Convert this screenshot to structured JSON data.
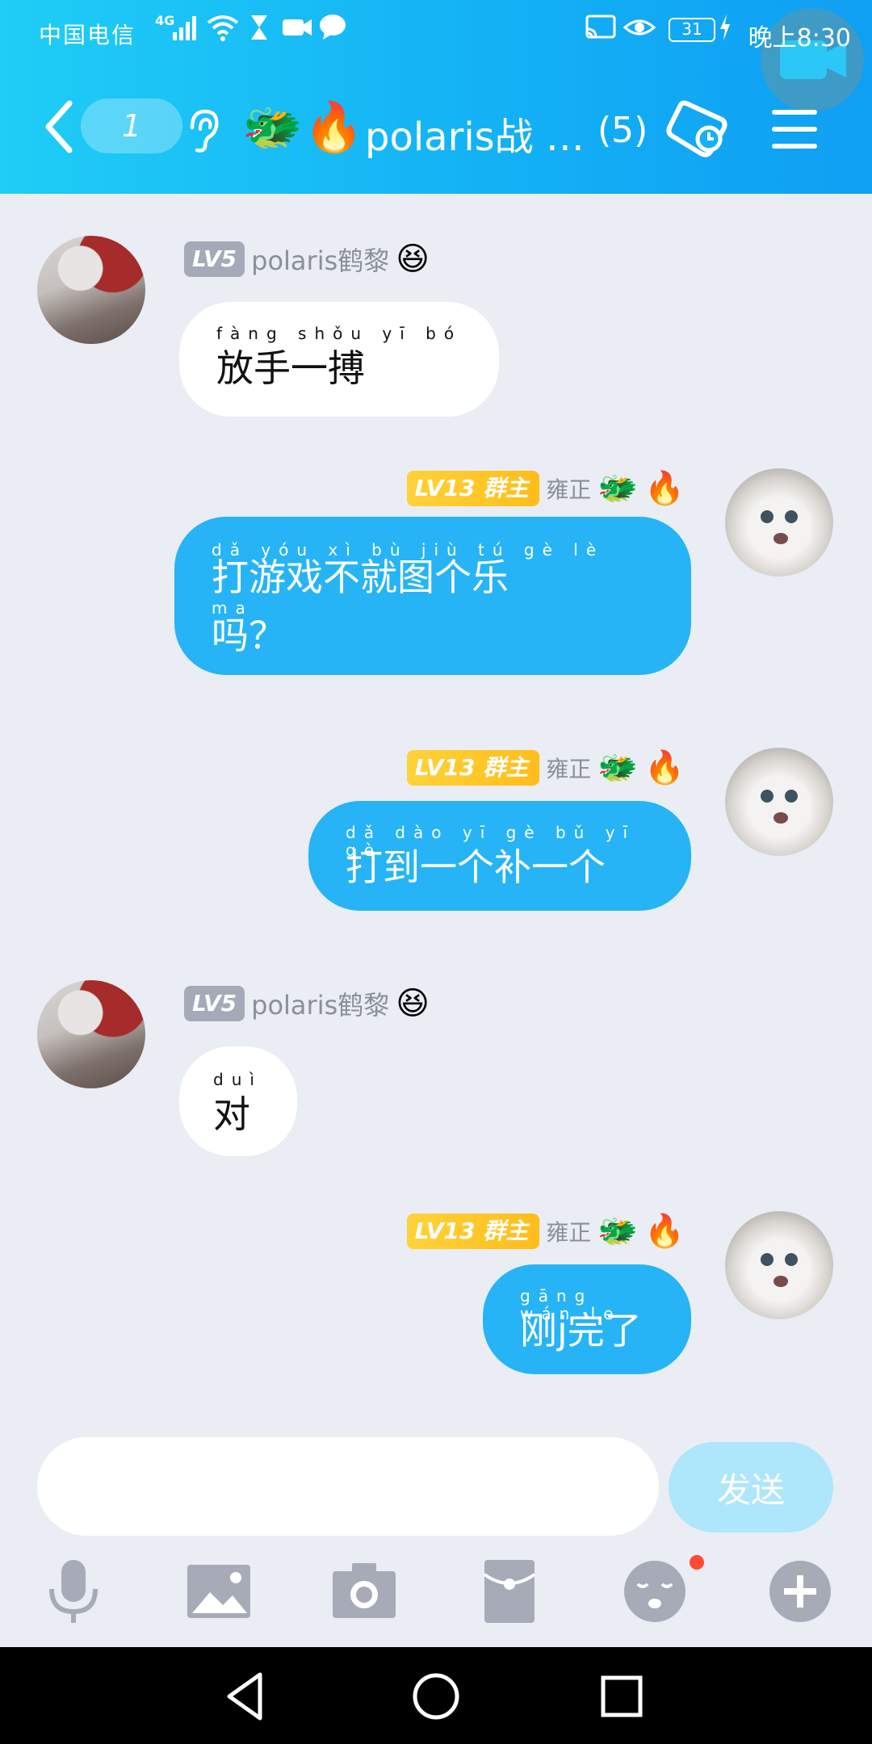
{
  "status_bar": {
    "carrier": "中国电信",
    "network": "4G",
    "battery": "31",
    "time": "晚上8:30"
  },
  "header": {
    "unread_count": "1",
    "title_emojis": [
      "🐲",
      "🔥"
    ],
    "group_name": "polaris战 …",
    "member_count": "(5)"
  },
  "messages": [
    {
      "side": "left",
      "level": "LV5",
      "role": "",
      "nickname": "polaris鹤黎",
      "nick_emojis": [
        "😆"
      ],
      "pinyin": [
        "fàng shǒu yī bó"
      ],
      "lines": [
        "放手一搏"
      ]
    },
    {
      "side": "right",
      "level": "LV13",
      "role": "群主",
      "nickname": "雍正",
      "nick_emojis": [
        "🐲",
        "🔥"
      ],
      "pinyin": [
        "dǎ yóu xì bù jiù tú gè lè",
        "ma"
      ],
      "lines": [
        "打游戏不就图个乐",
        "吗？"
      ]
    },
    {
      "side": "right",
      "level": "LV13",
      "role": "群主",
      "nickname": "雍正",
      "nick_emojis": [
        "🐲",
        "🔥"
      ],
      "pinyin": [
        "dǎ dào yī gè bǔ yī gè"
      ],
      "lines": [
        "打到一个补一个"
      ]
    },
    {
      "side": "left",
      "level": "LV5",
      "role": "",
      "nickname": "polaris鹤黎",
      "nick_emojis": [
        "😆"
      ],
      "pinyin": [
        "duì"
      ],
      "lines": [
        "对"
      ]
    },
    {
      "side": "right",
      "level": "LV13",
      "role": "群主",
      "nickname": "雍正",
      "nick_emojis": [
        "🐲",
        "🔥"
      ],
      "pinyin": [
        "gāng wán le"
      ],
      "lines": [
        "刚j完了"
      ]
    }
  ],
  "input": {
    "value": "",
    "send_label": "发送"
  },
  "toolbar": {
    "icons": [
      "microphone-icon",
      "image-icon",
      "camera-icon",
      "red-packet-icon",
      "emoji-icon",
      "plus-icon"
    ],
    "notification_dot": true
  },
  "colors": {
    "header_start": "#1fcdf6",
    "header_end": "#0f9ff3",
    "bubble_self": "#26b4f6",
    "bubble_other": "#ffffff",
    "background": "#eaedf3",
    "owner_badge": "#ffc828",
    "level_badge": "#a4aab7"
  }
}
